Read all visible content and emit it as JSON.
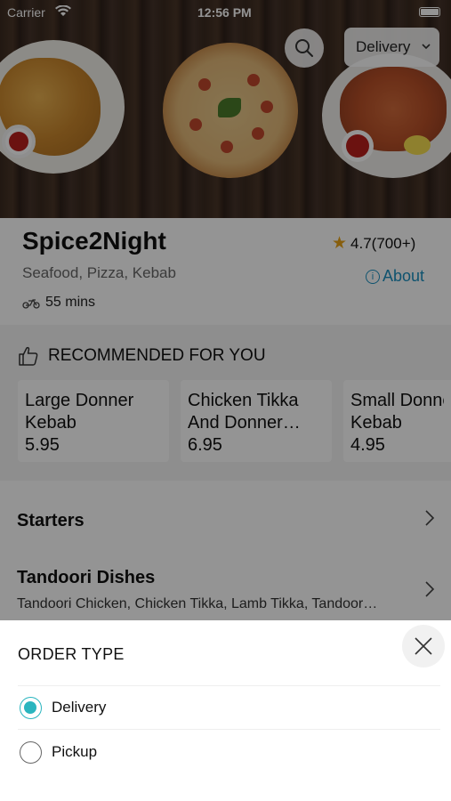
{
  "status_bar": {
    "carrier": "Carrier",
    "time": "12:56 PM"
  },
  "header": {
    "order_mode_label": "Delivery"
  },
  "restaurant": {
    "name": "Spice2Night",
    "rating": "4.7(700+)",
    "cuisines": "Seafood, Pizza, Kebab",
    "about_label": "About",
    "delivery_time": "55 mins"
  },
  "recommended": {
    "title": "RECOMMENDED FOR YOU",
    "items": [
      {
        "line1": "Large Donner",
        "line2": "Kebab",
        "price": "5.95"
      },
      {
        "line1": "Chicken Tikka",
        "line2": "And Donner…",
        "price": "6.95"
      },
      {
        "line1": "Small Donner",
        "line2": "Kebab",
        "price": "4.95"
      }
    ]
  },
  "categories": [
    {
      "title": "Starters",
      "subtitle": ""
    },
    {
      "title": "Tandoori Dishes",
      "subtitle": "Tandoori Chicken, Chicken Tikka, Lamb Tikka, Tandoor…"
    }
  ],
  "order_type_sheet": {
    "title": "ORDER TYPE",
    "options": [
      {
        "label": "Delivery",
        "selected": true
      },
      {
        "label": "Pickup",
        "selected": false
      }
    ]
  },
  "colors": {
    "accent": "#2ab5bf",
    "link": "#1a8fbf",
    "star": "#e8a317"
  },
  "icons": [
    "search-icon",
    "chevron-down-icon",
    "star-icon",
    "info-icon",
    "scooter-icon",
    "thumbs-up-icon",
    "chevron-right-icon",
    "close-icon"
  ]
}
